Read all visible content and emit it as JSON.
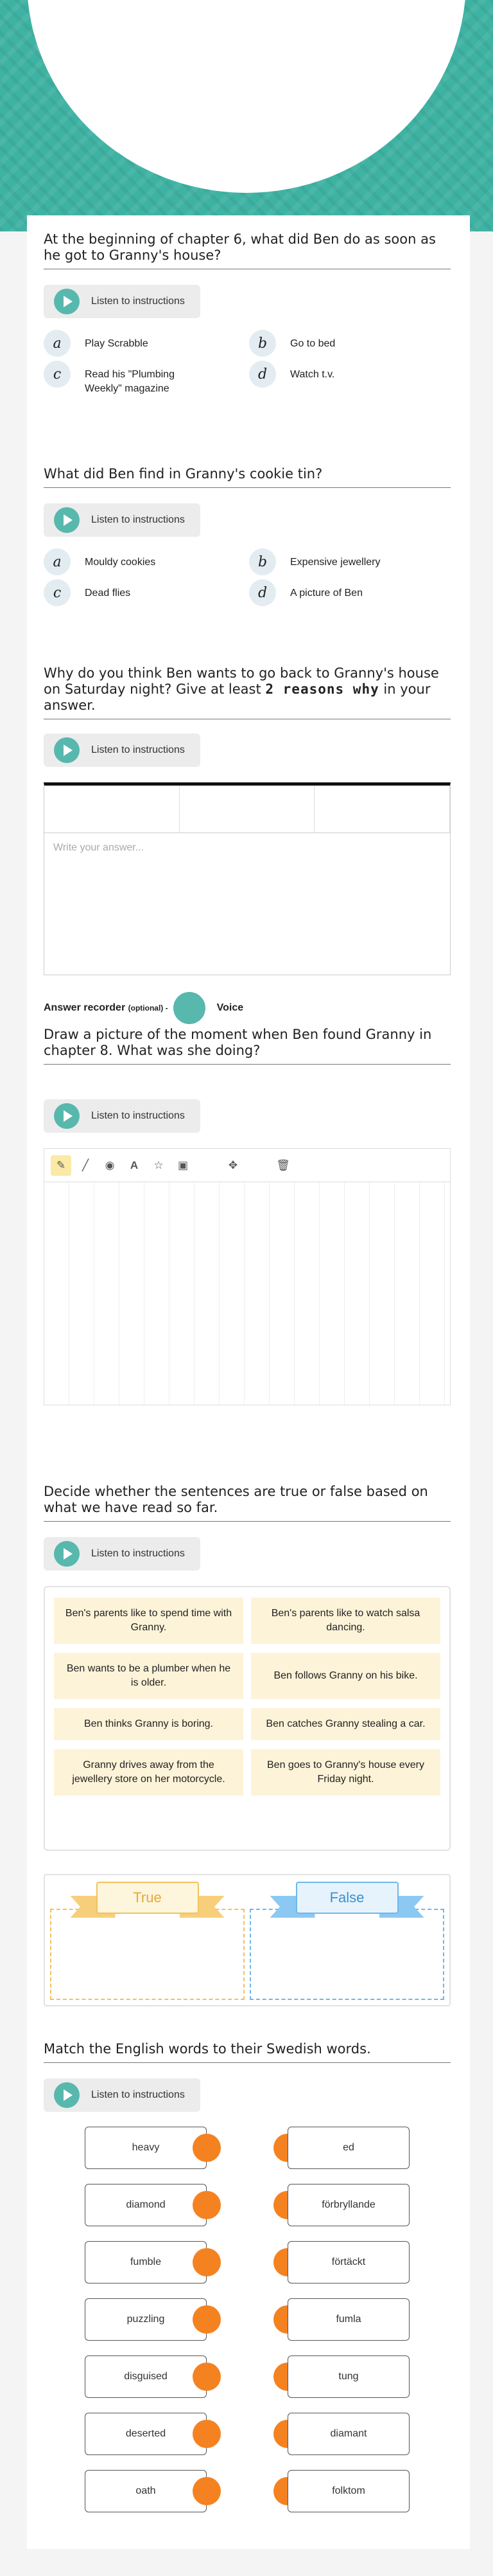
{
  "q1": {
    "title": "At the beginning of chapter 6, what did Ben do as soon as he got to Granny's house?",
    "listen": "Listen to instructions",
    "options": [
      {
        "letter": "a",
        "text": "Play Scrabble"
      },
      {
        "letter": "b",
        "text": "Go to bed"
      },
      {
        "letter": "c",
        "text": "Read his \"Plumbing Weekly\" magazine"
      },
      {
        "letter": "d",
        "text": "Watch t.v."
      }
    ]
  },
  "q2": {
    "title": "What did Ben find in Granny's cookie tin?",
    "listen": "Listen to instructions",
    "options": [
      {
        "letter": "a",
        "text": "Mouldy cookies"
      },
      {
        "letter": "b",
        "text": "Expensive jewellery"
      },
      {
        "letter": "c",
        "text": "Dead flies"
      },
      {
        "letter": "d",
        "text": "A picture of Ben"
      }
    ]
  },
  "q3": {
    "title_start": "Why do you think Ben wants to go back to Granny's house on Saturday night? Give at least ",
    "title_bold": "2 reasons why",
    "title_end": " in your answer.",
    "listen": "Listen to instructions",
    "placeholder": "Write your answer...",
    "recorder_label": "Answer recorder",
    "recorder_optional": "(optional) -",
    "voice": "Voice"
  },
  "q4": {
    "title": "Draw a picture of the moment when Ben found Granny in chapter 8.  What was she doing?",
    "listen": "Listen to instructions",
    "tools": [
      "pencil-icon",
      "pen-icon",
      "color-wheel-icon",
      "text-icon",
      "star-icon",
      "image-icon",
      "move-icon",
      "trash-icon"
    ]
  },
  "q5": {
    "title": "Decide whether the sentences are true or false based on what we have read so far.",
    "listen": "Listen to instructions",
    "cards": [
      "Ben's parents like to spend time with Granny.",
      "Ben's parents like to watch salsa dancing.",
      "Ben wants to be a plumber when he is older.",
      "Ben follows Granny on his bike.",
      "Ben thinks Granny is boring.",
      "Ben catches Granny stealing a car.",
      "Granny drives away from the jewellery store on her motorcycle.",
      "Ben goes to Granny's house every Friday night."
    ],
    "true_label": "True",
    "false_label": "False",
    "colors": {
      "card": "#fdf3d8",
      "true": "#f2c15c",
      "false": "#6fb7ea"
    }
  },
  "q6": {
    "title": "Match the English words to their Swedish words.",
    "listen": "Listen to instructions",
    "left": [
      "heavy",
      "diamond",
      "fumble",
      "puzzling",
      "disguised",
      "deserted",
      "oath"
    ],
    "right": [
      "ed",
      "förbryllande",
      "förtäckt",
      "fumla",
      "tung",
      "diamant",
      "folktom"
    ],
    "dot_color": "#f58220"
  }
}
